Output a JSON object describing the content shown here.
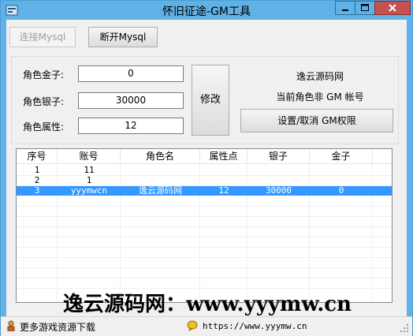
{
  "window": {
    "title": "怀旧征途-GM工具"
  },
  "toolbar": {
    "connect_label": "连接Mysql",
    "disconnect_label": "断开Mysql"
  },
  "form": {
    "gold_label": "角色金子:",
    "gold_value": "0",
    "silver_label": "角色银子:",
    "silver_value": "30000",
    "attr_label": "角色属性:",
    "attr_value": "12",
    "modify_label": "修改"
  },
  "info": {
    "site": "逸云源码网",
    "gm_status": "当前角色非 GM 帐号",
    "gm_toggle_label": "设置/取消 GM权限"
  },
  "table": {
    "columns": [
      "序号",
      "账号",
      "角色名",
      "属性点",
      "银子",
      "金子"
    ],
    "rows": [
      [
        "1",
        "11",
        "",
        "",
        "",
        ""
      ],
      [
        "2",
        "1",
        "",
        "",
        "",
        ""
      ],
      [
        "3",
        "yyymwcn",
        "逸云源码网",
        "12",
        "30000",
        "0"
      ]
    ],
    "selected_row": 2
  },
  "watermark": "逸云源码网：www.yyymw.cn",
  "status": {
    "left_text": "更多游戏资源下载",
    "right_text": "https://www.yyymw.cn"
  },
  "colors": {
    "titlebar": "#5fb1e6",
    "selection": "#3399ff",
    "close": "#c75050"
  }
}
